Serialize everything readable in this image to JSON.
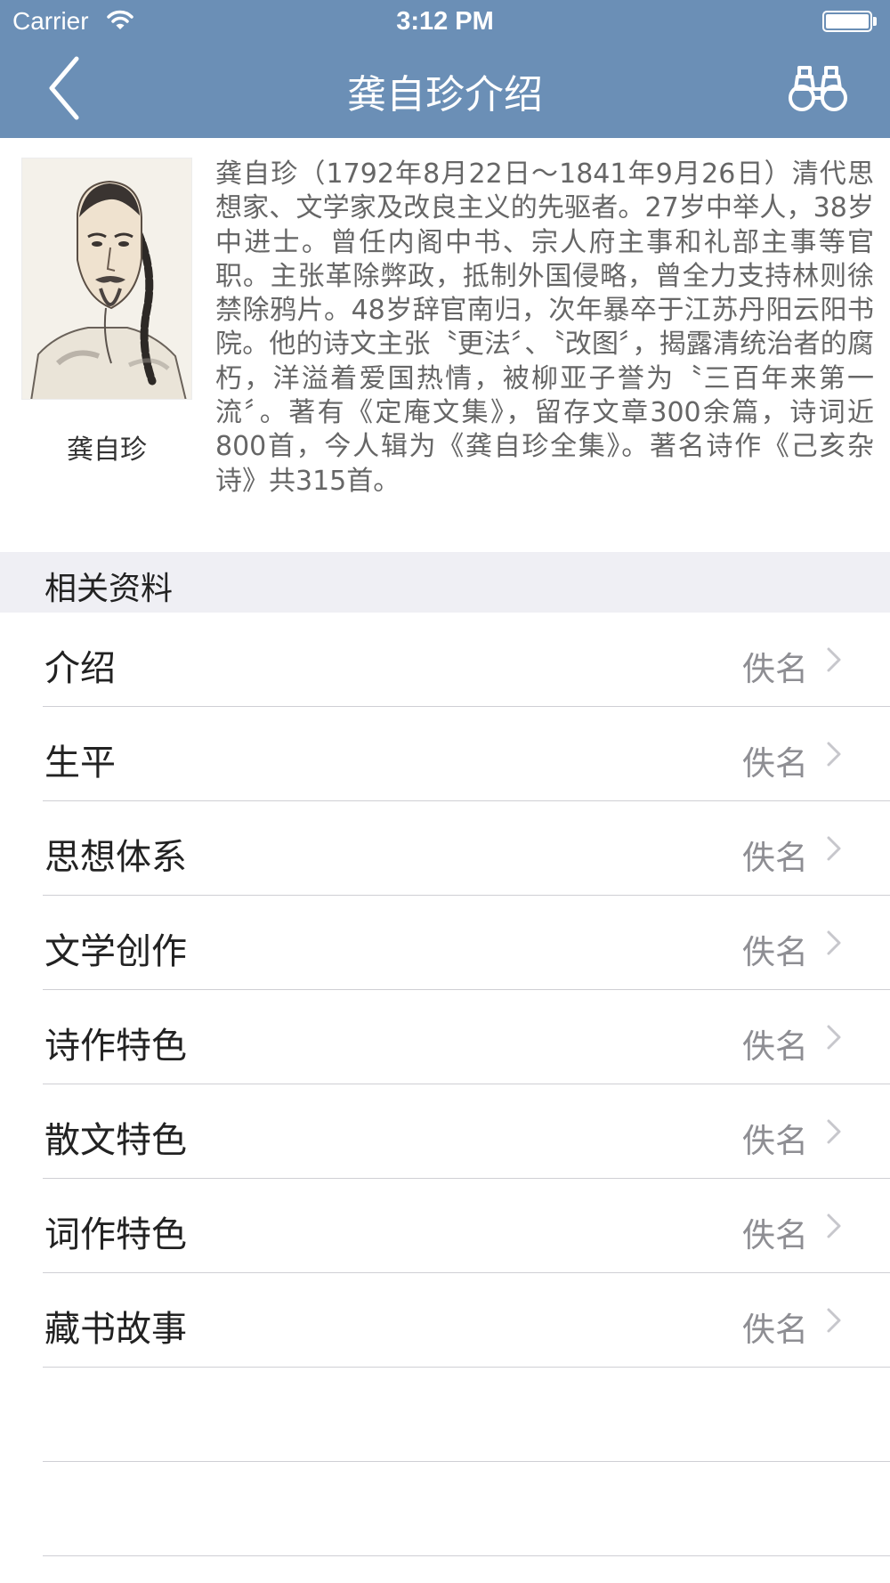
{
  "status_bar": {
    "carrier": "Carrier",
    "time": "3:12 PM"
  },
  "nav": {
    "title": "龚自珍介绍",
    "back_icon": "chevron-left-icon",
    "action_icon": "binoculars-icon"
  },
  "intro": {
    "portrait_caption": "龚自珍",
    "bio": "龚自珍（1792年8月22日～1841年9月26日）清代思想家、文学家及改良主义的先驱者。27岁中举人，38岁中进士。曾任内阁中书、宗人府主事和礼部主事等官职。主张革除弊政，抵制外国侵略，曾全力支持林则徐禁除鸦片。48岁辞官南归，次年暴卒于江苏丹阳云阳书院。他的诗文主张〝更法〞、〝改图〞，揭露清统治者的腐朽，洋溢着爱国热情，被柳亚子誉为〝三百年来第一流〞。著有《定庵文集》，留存文章300余篇，诗词近800首，今人辑为《龚自珍全集》。著名诗作《己亥杂诗》共315首。"
  },
  "section": {
    "title": "相关资料"
  },
  "items": [
    {
      "label": "介绍",
      "value": "佚名"
    },
    {
      "label": "生平",
      "value": "佚名"
    },
    {
      "label": "思想体系",
      "value": "佚名"
    },
    {
      "label": "文学创作",
      "value": "佚名"
    },
    {
      "label": "诗作特色",
      "value": "佚名"
    },
    {
      "label": "散文特色",
      "value": "佚名"
    },
    {
      "label": "词作特色",
      "value": "佚名"
    },
    {
      "label": "藏书故事",
      "value": "佚名"
    }
  ],
  "colors": {
    "nav_background": "#6b8fb6",
    "section_background": "#efeff4",
    "secondary_text": "#8e8e93"
  }
}
